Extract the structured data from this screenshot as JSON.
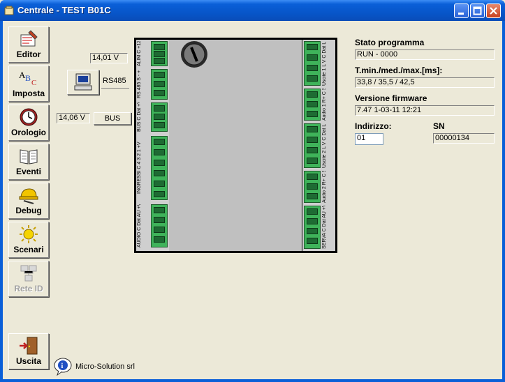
{
  "window": {
    "title": "Centrale - TEST B01C"
  },
  "toolbar": {
    "items": [
      {
        "label": "Editor"
      },
      {
        "label": "Imposta"
      },
      {
        "label": "Orologio"
      },
      {
        "label": "Eventi"
      },
      {
        "label": "Debug"
      },
      {
        "label": "Scenari"
      },
      {
        "label": "Rete ID"
      }
    ],
    "exit_label": "Uscita"
  },
  "connection": {
    "rs485_voltage": "14,01 V",
    "rs485_label": "RS485",
    "bus_voltage": "14,06 V",
    "bus_button": "BUS"
  },
  "board": {
    "left_labels": [
      "ALIM C +12V",
      "RS 485 S - +",
      "BUS C Dat +V",
      "INGRESSI C 4 3 2 1 +V",
      "AUDIO C Dat AU +V"
    ],
    "right_labels": [
      "Uscite 1 L V C Dat L R",
      "Audio 1 R+ C SPK R-",
      "Uscite 2 L V C Dat L R",
      "Audio 2 R+ C SPK R-",
      "SERVA C Dat AU +VS"
    ]
  },
  "info": {
    "stato_label": "Stato programma",
    "stato_value": "RUN - 0000",
    "tmin_label": "T.min./med./max.[ms]:",
    "tmin_value": "33,8 / 35,5 / 42,5",
    "firmware_label": "Versione firmware",
    "firmware_value": "7.47   1-03-11  12:21",
    "indirizzo_label": "Indirizzo:",
    "indirizzo_value": "01",
    "sn_label": "SN",
    "sn_value": "00000134"
  },
  "footer": {
    "company": "Micro-Solution srl"
  }
}
